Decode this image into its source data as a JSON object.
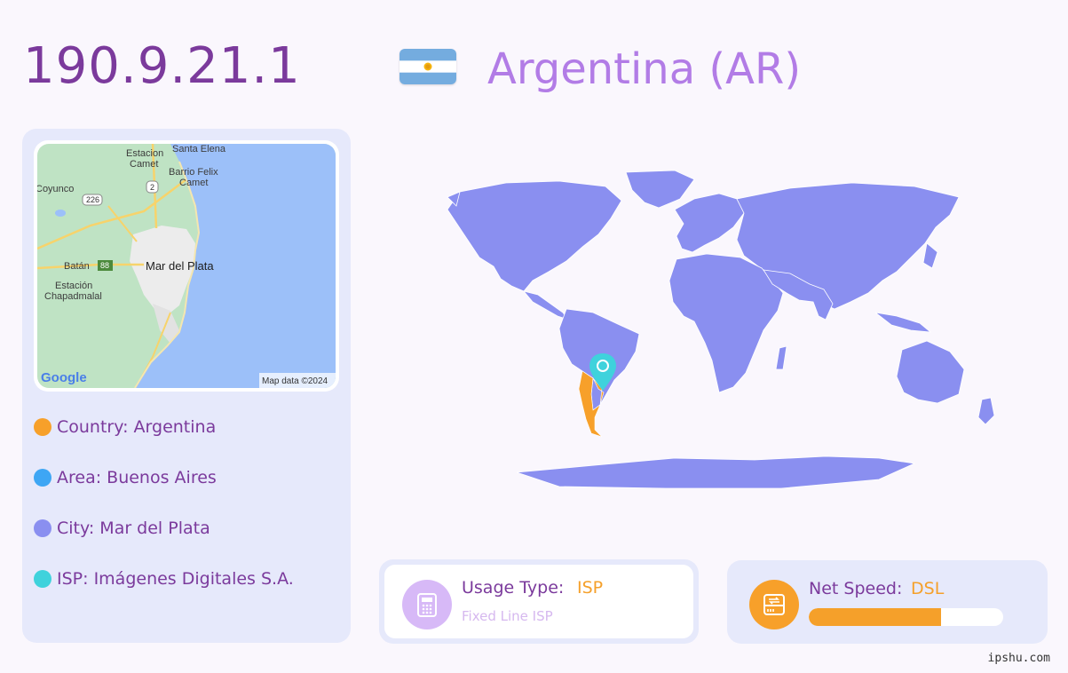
{
  "header": {
    "ip": "190.9.21.1",
    "country_title": "Argentina (AR)",
    "flag_icon": "argentina-flag-icon"
  },
  "location_panel": {
    "map": {
      "labels": {
        "estacion_camet": "Estacion Camet",
        "estacion_camet_l1": "Estacion",
        "estacion_camet_l2": "Camet",
        "santa_elena": "Santa Elena",
        "barrio_felix_l1": "Barrio Felix",
        "barrio_felix_l2": "Camet",
        "coyunco": "Coyunco",
        "batan": "Batán",
        "mar_del_plata": "Mar del Plata",
        "chapadmalal_l1": "Estación",
        "chapadmalal_l2": "Chapadmalal",
        "route_226": "226",
        "route_2": "2",
        "route_88": "88"
      },
      "logo": "Google",
      "attribution": "Map data ©2024",
      "colors": {
        "water": "#9cc0f9",
        "land": "#bfe3c4",
        "urban": "#ececec",
        "road": "#f7d36b"
      }
    },
    "items": [
      {
        "text": "Country: Argentina",
        "color": "#f7a02a"
      },
      {
        "text": "Area: Buenos Aires",
        "color": "#3ea6f4"
      },
      {
        "text": "City: Mar del Plata",
        "color": "#8a8ff0"
      },
      {
        "text": "ISP: Imágenes Digitales S.A.",
        "color": "#3fd2dc"
      }
    ]
  },
  "world_map": {
    "land_color": "#8a8ff0",
    "highlight_color": "#f7a02a",
    "pin_color": "#3fd2dc",
    "highlighted_country": "Argentina"
  },
  "usage_card": {
    "label": "Usage Type:",
    "value": "ISP",
    "subtitle": "Fixed Line ISP",
    "icon": "phone-icon",
    "icon_color": "#d7b9f7"
  },
  "speed_card": {
    "label": "Net Speed:",
    "value": "DSL",
    "icon": "network-device-icon",
    "icon_color": "#f7a02a",
    "progress_fraction": 0.68
  },
  "footer": {
    "watermark": "ipshu.com"
  }
}
